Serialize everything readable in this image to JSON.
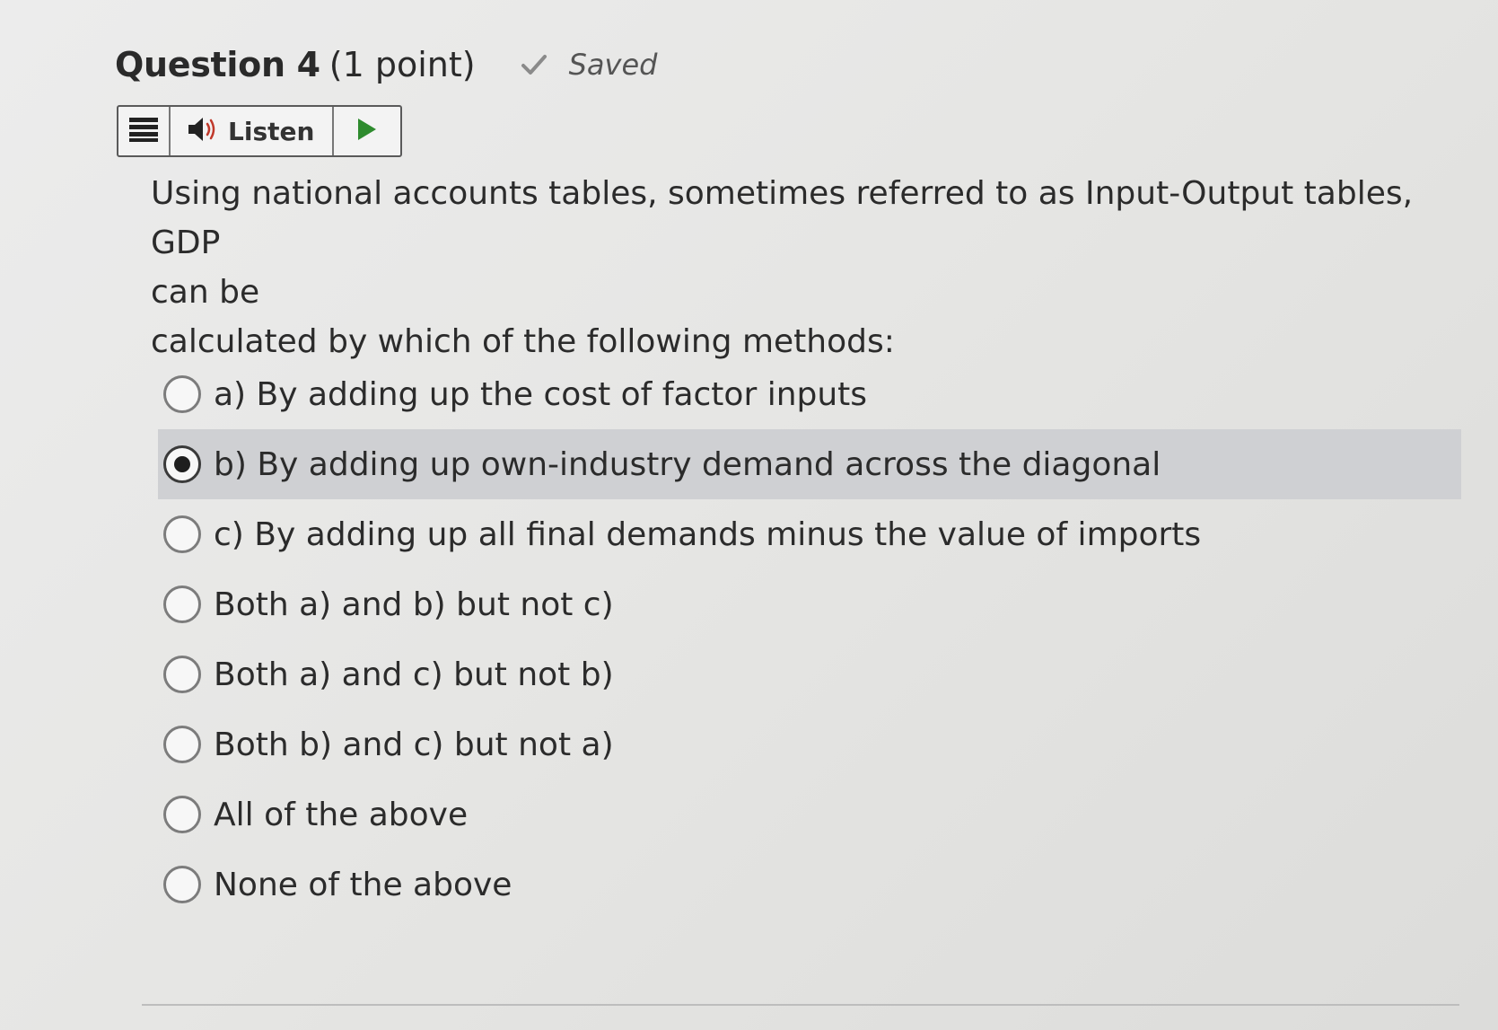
{
  "question": {
    "title": "Question 4",
    "points": "(1 point)",
    "status": "Saved"
  },
  "toolbar": {
    "menu_icon": "hamburger-menu-icon",
    "speaker_icon": "speaker-icon",
    "listen_label": "Listen",
    "play_icon": "play-icon",
    "play_color": "#2e8b2e"
  },
  "prompt": {
    "line1": "Using national accounts tables, sometimes referred to as Input-Output tables, GDP",
    "line2": "can be",
    "line3": "calculated by which of the following methods:"
  },
  "options": [
    {
      "label": "a) By adding up the cost of factor inputs",
      "selected": false
    },
    {
      "label": "b) By adding up own-industry demand across the diagonal",
      "selected": true
    },
    {
      "label": "c) By adding up all final demands minus the value of imports",
      "selected": false
    },
    {
      "label": "Both a) and b) but not c)",
      "selected": false
    },
    {
      "label": "Both a) and c) but not b)",
      "selected": false
    },
    {
      "label": "Both b) and c) but not a)",
      "selected": false
    },
    {
      "label": "All of the above",
      "selected": false
    },
    {
      "label": "None of the above",
      "selected": false
    }
  ],
  "colors": {
    "selected_row_bg": "#cfd0d3",
    "check_color": "#8a8a8a"
  }
}
